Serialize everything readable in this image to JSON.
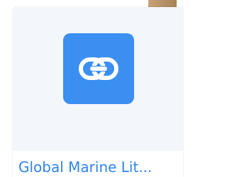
{
  "card": {
    "title": "Global Marine Lit...",
    "icon": "link-icon",
    "accent_color": "#3a8ff1",
    "title_color": "#2f84ea"
  }
}
